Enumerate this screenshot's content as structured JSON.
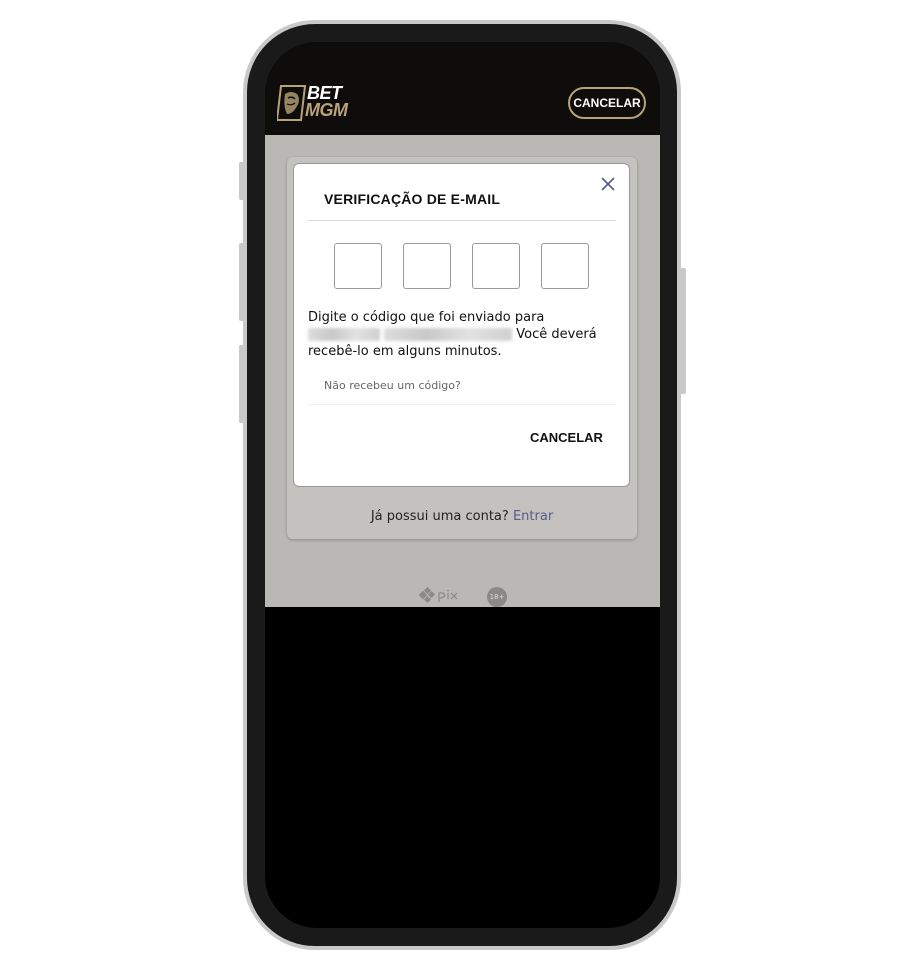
{
  "header": {
    "logo_top": "BET",
    "logo_bottom": "MGM",
    "cancel_label": "CANCELAR"
  },
  "modal": {
    "title": "VERIFICAÇÃO DE E-MAIL",
    "code_boxes": [
      "",
      "",
      "",
      ""
    ],
    "message_part1": "Digite o código que foi enviado para",
    "message_part2": "Você deverá recebê-lo em alguns minutos.",
    "resend_link": "Não recebeu um código?",
    "cancel_label": "CANCELAR"
  },
  "card": {
    "footer_text": "Já possui uma conta?",
    "footer_link": "Entrar"
  },
  "badges": {
    "age": "18+"
  },
  "colors": {
    "gold": "#b9a277",
    "link": "#5a5b8a"
  }
}
